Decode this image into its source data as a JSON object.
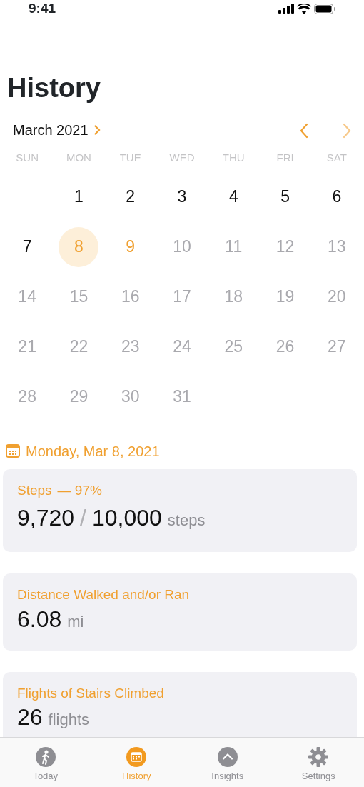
{
  "status_bar": {
    "time": "9:41"
  },
  "title": "History",
  "calendar": {
    "month": "March 2021",
    "weekdays": [
      "SUN",
      "MON",
      "TUE",
      "WED",
      "THU",
      "FRI",
      "SAT"
    ],
    "days": [
      {
        "label": "1",
        "selected": false,
        "today": false,
        "disabled": false
      },
      {
        "label": "2",
        "selected": false,
        "today": false,
        "disabled": false
      },
      {
        "label": "3",
        "selected": false,
        "today": false,
        "disabled": false
      },
      {
        "label": "4",
        "selected": false,
        "today": false,
        "disabled": false
      },
      {
        "label": "5",
        "selected": false,
        "today": false,
        "disabled": false
      },
      {
        "label": "6",
        "selected": false,
        "today": false,
        "disabled": false
      },
      {
        "label": "7",
        "selected": false,
        "today": false,
        "disabled": false
      },
      {
        "label": "8",
        "selected": true,
        "today": false,
        "disabled": false
      },
      {
        "label": "9",
        "selected": false,
        "today": true,
        "disabled": false
      },
      {
        "label": "10",
        "selected": false,
        "today": false,
        "disabled": true
      },
      {
        "label": "11",
        "selected": false,
        "today": false,
        "disabled": true
      },
      {
        "label": "12",
        "selected": false,
        "today": false,
        "disabled": true
      },
      {
        "label": "13",
        "selected": false,
        "today": false,
        "disabled": true
      },
      {
        "label": "14",
        "selected": false,
        "today": false,
        "disabled": true
      },
      {
        "label": "15",
        "selected": false,
        "today": false,
        "disabled": true
      },
      {
        "label": "16",
        "selected": false,
        "today": false,
        "disabled": true
      },
      {
        "label": "17",
        "selected": false,
        "today": false,
        "disabled": true
      },
      {
        "label": "18",
        "selected": false,
        "today": false,
        "disabled": true
      },
      {
        "label": "19",
        "selected": false,
        "today": false,
        "disabled": true
      },
      {
        "label": "20",
        "selected": false,
        "today": false,
        "disabled": true
      },
      {
        "label": "21",
        "selected": false,
        "today": false,
        "disabled": true
      },
      {
        "label": "22",
        "selected": false,
        "today": false,
        "disabled": true
      },
      {
        "label": "23",
        "selected": false,
        "today": false,
        "disabled": true
      },
      {
        "label": "24",
        "selected": false,
        "today": false,
        "disabled": true
      },
      {
        "label": "25",
        "selected": false,
        "today": false,
        "disabled": true
      },
      {
        "label": "26",
        "selected": false,
        "today": false,
        "disabled": true
      },
      {
        "label": "27",
        "selected": false,
        "today": false,
        "disabled": true
      },
      {
        "label": "28",
        "selected": false,
        "today": false,
        "disabled": true
      },
      {
        "label": "29",
        "selected": false,
        "today": false,
        "disabled": true
      },
      {
        "label": "30",
        "selected": false,
        "today": false,
        "disabled": true
      },
      {
        "label": "31",
        "selected": false,
        "today": false,
        "disabled": true
      }
    ]
  },
  "selected_date": "Monday, Mar 8, 2021",
  "cards": [
    {
      "kind": "goal",
      "title": "Steps",
      "percent": "— 97%",
      "value": "9,720",
      "separator": "/",
      "goal": "10,000",
      "unit": "steps"
    },
    {
      "kind": "plain",
      "title": "Distance Walked and/or Ran",
      "value": "6.08",
      "unit": "mi"
    },
    {
      "kind": "plain",
      "title": "Flights of Stairs Climbed",
      "value": "26",
      "unit": "flights"
    }
  ],
  "tabs": [
    {
      "kind": "walk",
      "label": "Today",
      "selected": false
    },
    {
      "kind": "calendar",
      "label": "History",
      "selected": true
    },
    {
      "kind": "chevron",
      "label": "Insights",
      "selected": false
    },
    {
      "kind": "gear",
      "label": "Settings",
      "selected": false
    }
  ]
}
